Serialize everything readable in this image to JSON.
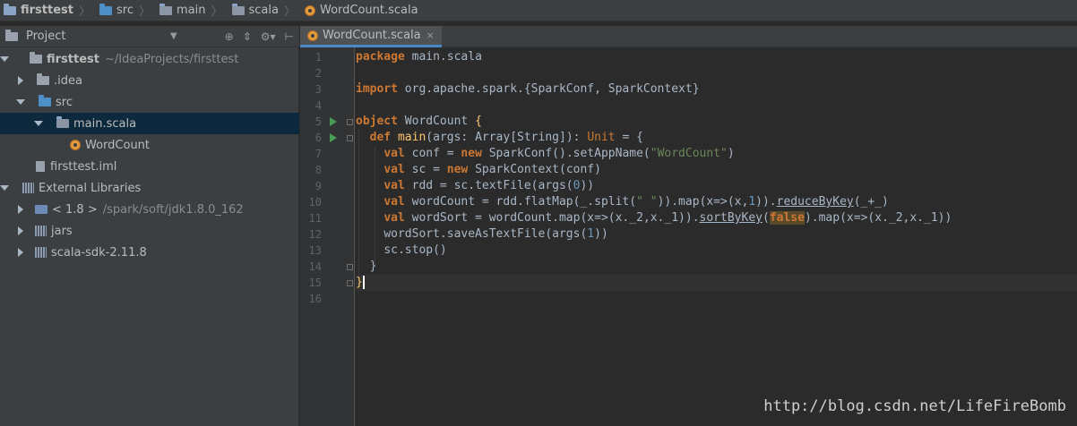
{
  "breadcrumb": [
    "firsttest",
    "src",
    "main",
    "scala",
    "WordCount.scala"
  ],
  "project_panel": {
    "title": "Project"
  },
  "tree": [
    {
      "label": "firsttest",
      "path": "~/IdeaProjects/firsttest"
    },
    {
      "label": ".idea"
    },
    {
      "label": "src"
    },
    {
      "label": "main.scala"
    },
    {
      "label": "WordCount"
    },
    {
      "label": "firsttest.iml"
    },
    {
      "label": "External Libraries"
    },
    {
      "label": "< 1.8 >",
      "path": "/spark/soft/jdk1.8.0_162"
    },
    {
      "label": "jars"
    },
    {
      "label": "scala-sdk-2.11.8"
    }
  ],
  "editor": {
    "tab": "WordCount.scala",
    "line_numbers": [
      "1",
      "2",
      "3",
      "4",
      "5",
      "6",
      "7",
      "8",
      "9",
      "10",
      "11",
      "12",
      "13",
      "14",
      "15",
      "16"
    ]
  },
  "code": {
    "l1_kw": "package",
    "l1_rest": " main.scala",
    "l3_kw": "import",
    "l3_rest": " org.apache.spark.{SparkConf, SparkContext}",
    "l5_kw": "object",
    "l5_name": " WordCount ",
    "l5_brace": "{",
    "l6_kw": "def",
    "l6_name": " main",
    "l6_rest1": "(args: Array[",
    "l6_type": "String",
    "l6_rest2": "]): ",
    "l6_unit": "Unit",
    "l6_rest3": " = {",
    "l7_kw": "val",
    "l7_a": " conf = ",
    "l7_new": "new",
    "l7_b": " SparkConf().setAppName(",
    "l7_str": "\"WordCount\"",
    "l7_c": ")",
    "l8_kw": "val",
    "l8_a": " sc = ",
    "l8_new": "new",
    "l8_b": " SparkContext(conf)",
    "l9_kw": "val",
    "l9_a": " rdd = sc.textFile(args(",
    "l9_num": "0",
    "l9_b": "))",
    "l10_kw": "val",
    "l10_a": " wordCount = rdd.flatMap(_.split(",
    "l10_str": "\" \"",
    "l10_b": ")).map(x=>(x,",
    "l10_num": "1",
    "l10_c": ")).",
    "l10_rbk": "reduceByKey",
    "l10_d": "(_+_)",
    "l11_kw": "val",
    "l11_a": " wordSort = wordCount.map(x=>(x._2,x._1)).",
    "l11_sbk": "sortByKey",
    "l11_b": "(",
    "l11_false": "false",
    "l11_c": ").map(x=>(x._2,x._1))",
    "l12": "wordSort.saveAsTextFile(args(",
    "l12_num": "1",
    "l12_b": "))",
    "l13": "sc.stop()",
    "l14": "}",
    "l15": "}"
  },
  "watermark": "http://blog.csdn.net/LifeFireBomb"
}
